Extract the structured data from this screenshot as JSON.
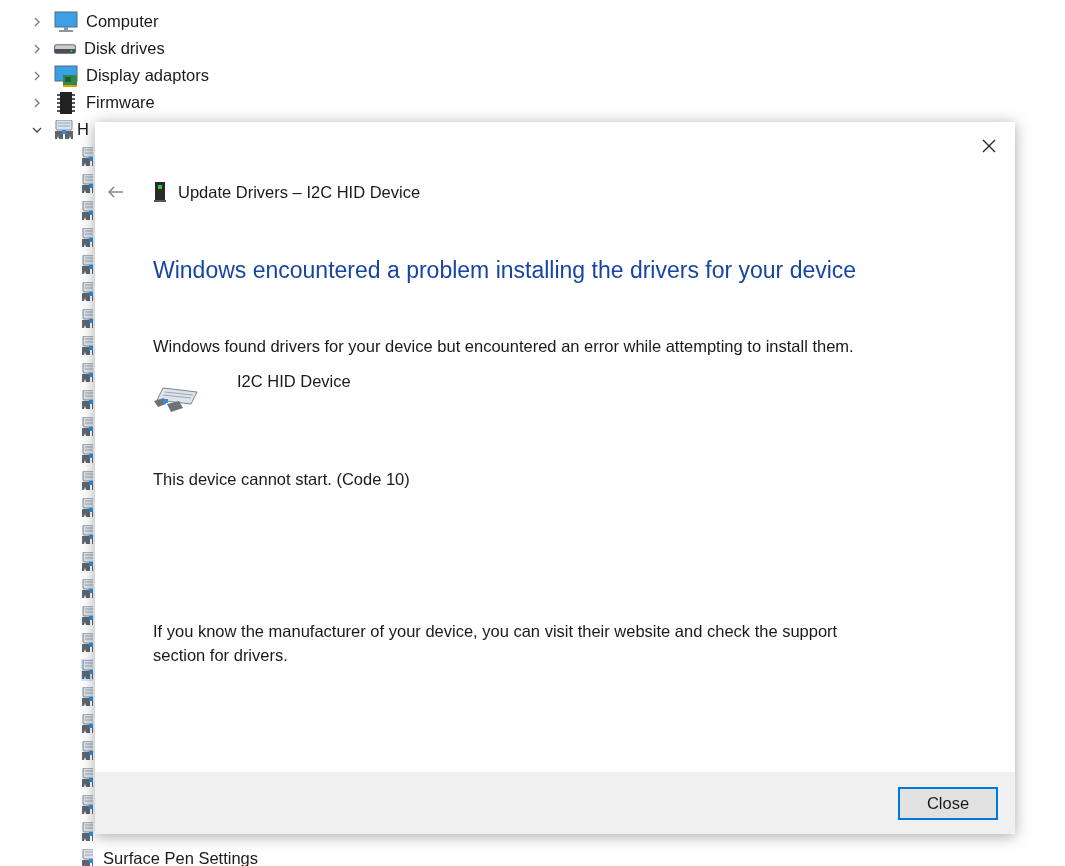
{
  "tree": {
    "items": [
      {
        "label": "Computer",
        "expanded": false,
        "kind": "computer"
      },
      {
        "label": "Disk drives",
        "expanded": false,
        "kind": "disk"
      },
      {
        "label": "Display adaptors",
        "expanded": false,
        "kind": "display"
      },
      {
        "label": "Firmware",
        "expanded": false,
        "kind": "chip"
      },
      {
        "label": "H",
        "expanded": true,
        "kind": "hid",
        "children": [
          {
            "selected": false
          },
          {
            "selected": false
          },
          {
            "selected": false
          },
          {
            "selected": false
          },
          {
            "selected": false
          },
          {
            "selected": false
          },
          {
            "selected": false
          },
          {
            "selected": false
          },
          {
            "selected": false
          },
          {
            "selected": false
          },
          {
            "selected": false
          },
          {
            "selected": false
          },
          {
            "selected": false
          },
          {
            "selected": false
          },
          {
            "selected": false
          },
          {
            "selected": false
          },
          {
            "selected": false
          },
          {
            "selected": false
          },
          {
            "selected": false
          },
          {
            "selected": true
          },
          {
            "selected": false
          },
          {
            "selected": false
          },
          {
            "selected": false
          },
          {
            "selected": false
          },
          {
            "selected": false
          },
          {
            "selected": false
          },
          {
            "label": "Surface Pen Settings",
            "selected": false
          }
        ]
      }
    ]
  },
  "dialog": {
    "title": "Update Drivers – I2C HID Device",
    "heading": "Windows encountered a problem installing the drivers for your device",
    "message": "Windows found drivers for your device but encountered an error while attempting to install them.",
    "device_name": "I2C HID Device",
    "status": "This device cannot start. (Code 10)",
    "hint": "If you know the manufacturer of your device, you can visit their website and check the support section for drivers.",
    "buttons": [
      "Close"
    ]
  }
}
